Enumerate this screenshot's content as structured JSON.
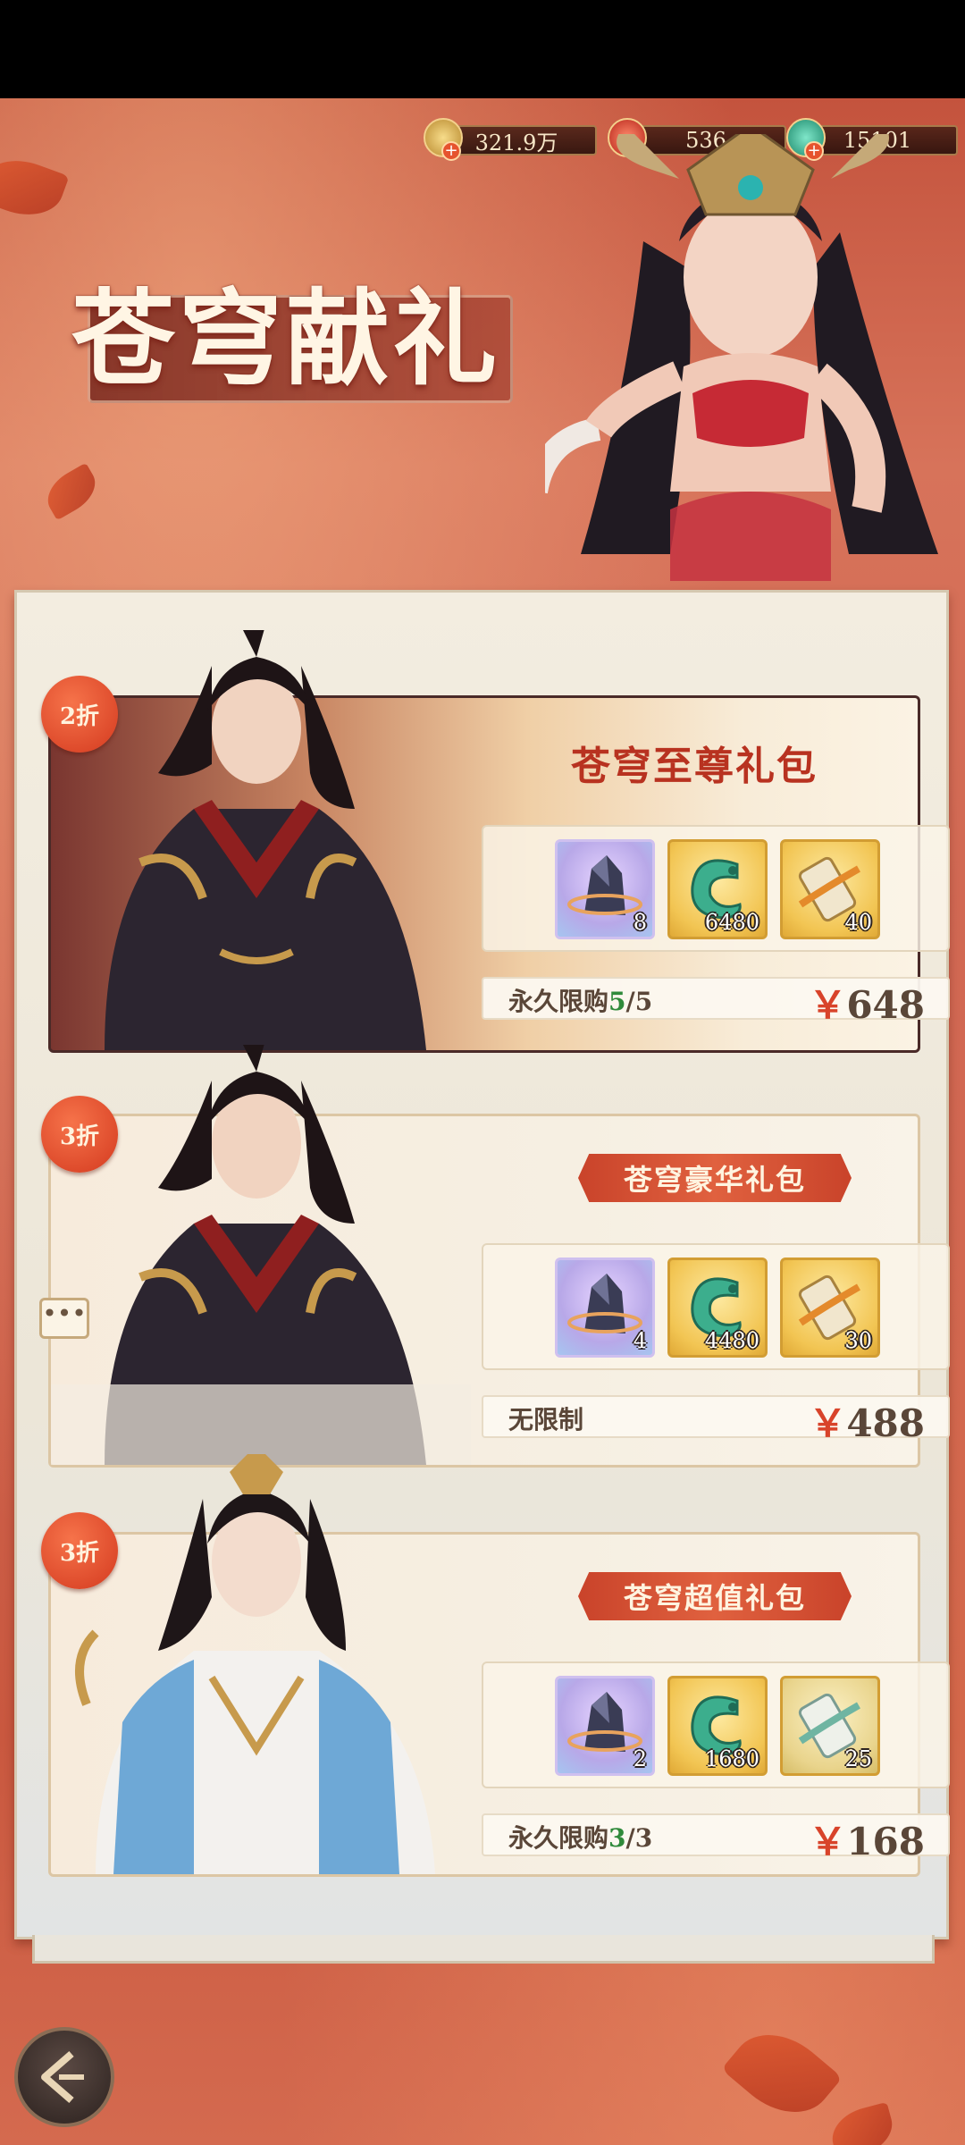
{
  "currencies": [
    {
      "name": "copper-coin",
      "value": "321.9万",
      "color": "#e8c46a"
    },
    {
      "name": "red-jade",
      "value": "536",
      "color": "#e24a3b"
    },
    {
      "name": "green-jade",
      "value": "15101",
      "color": "#3bb89a"
    }
  ],
  "event_title": "苍穹献礼",
  "packs": [
    {
      "discount": "2折",
      "title": "苍穹至尊礼包",
      "items": [
        {
          "icon": "crystal-icon",
          "count": "8"
        },
        {
          "icon": "jade-dragon-icon",
          "count": "6480"
        },
        {
          "icon": "scroll-icon",
          "count": "40"
        }
      ],
      "limit_label": "永久限购",
      "limit_bought": "5",
      "limit_total": "/5",
      "currency_symbol": "￥",
      "price": "648"
    },
    {
      "discount": "3折",
      "title": "苍穹豪华礼包",
      "items": [
        {
          "icon": "crystal-icon",
          "count": "4"
        },
        {
          "icon": "jade-dragon-icon",
          "count": "4480"
        },
        {
          "icon": "scroll-icon",
          "count": "30"
        }
      ],
      "limit_label": "无限制",
      "currency_symbol": "￥",
      "price": "488"
    },
    {
      "discount": "3折",
      "title": "苍穹超值礼包",
      "items": [
        {
          "icon": "crystal-icon",
          "count": "2"
        },
        {
          "icon": "jade-dragon-icon",
          "count": "1680"
        },
        {
          "icon": "jade-scroll-icon",
          "count": "25"
        }
      ],
      "limit_label": "永久限购",
      "limit_bought": "3",
      "limit_total": "/3",
      "currency_symbol": "￥",
      "price": "168"
    }
  ],
  "chat_icon_glyph": "•••"
}
